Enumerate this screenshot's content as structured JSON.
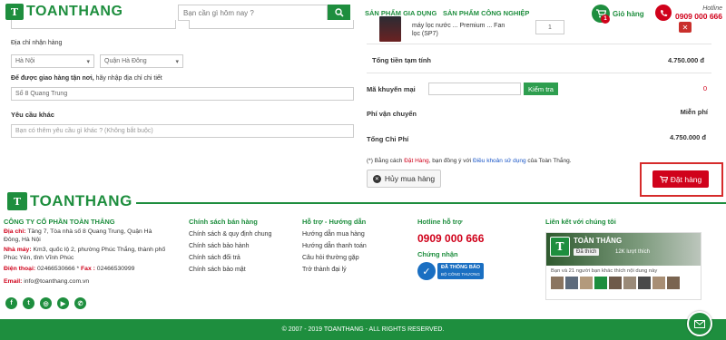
{
  "header": {
    "logo_text": "TOANTHANG",
    "logo_mark": "T",
    "search_placeholder": "Bạn cần gì hôm nay ?",
    "nav": [
      "SẢN PHẨM GIA DỤNG",
      "SẢN PHẨM CÔNG NGHIỆP"
    ],
    "cart_label": "Giỏ hàng",
    "cart_count": "1",
    "hotline_label": "Hotline",
    "hotline_number": "0909 000 666"
  },
  "form": {
    "address_label": "Địa chỉ nhận hàng",
    "city_value": "Hà Nội",
    "district_value": "Quận Hà Đông",
    "delivery_label_bold": "Để được giao hàng tận nơi,",
    "delivery_label_rest": " hãy nhập địa chỉ chi tiết",
    "street_value": "Số 8 Quang Trung",
    "request_label": "Yêu cầu khác",
    "request_placeholder": "Bạn có thêm yêu cầu gì khác ? (Không bắt buộc)"
  },
  "order": {
    "product_name_line1": "máy lọc nước ... Premium ... Fan",
    "product_name_line2": "lọc (SP7)",
    "quantity": "1",
    "subtotal_label": "Tổng tiền tạm tính",
    "subtotal_value": "4.750.000 đ",
    "promo_label": "Mã khuyến mại",
    "promo_button": "Kiểm tra",
    "promo_value": "0",
    "shipping_label": "Phí vận chuyển",
    "shipping_value": "Miễn phí",
    "total_label": "Tổng Chi Phí",
    "total_value": "4.750.000 đ",
    "terms_prefix": "(*) Bằng cách ",
    "terms_order": "Đặt Hàng",
    "terms_mid": ", bạn đồng ý với ",
    "terms_link": "Điều khoản sử dụng",
    "terms_suffix": " của Toàn Thắng.",
    "cancel_button": "Hủy mua hàng",
    "order_button": "Đặt hàng"
  },
  "footer": {
    "company_name": "CÔNG TY CỔ PHẦN TOÀN THẮNG",
    "address_label": "Địa chỉ:",
    "address_value": " Tầng 7, Tòa nhà số 8 Quang Trung, Quận Hà Đông, Hà Nội",
    "factory_label": "Nhà máy:",
    "factory_value": " Km3, quốc lộ 2, phường Phúc Thắng, thành phố Phúc Yên, tỉnh Vĩnh Phúc",
    "phone_label": "Điện thoại:",
    "phone_value": " 02466530666 * ",
    "fax_label": "Fax :",
    "fax_value": " 02466530999",
    "email_label": "Email:",
    "email_value": " info@toanthang.com.vn",
    "policy_title": "Chính sách bán hàng",
    "policy_links": [
      "Chính sách & quy định chung",
      "Chính sách bảo hành",
      "Chính sách đổi trả",
      "Chính sách bảo mật"
    ],
    "support_title": "Hỗ trợ - Hướng dẫn",
    "support_links": [
      "Hướng dẫn mua hàng",
      "Hướng dẫn thanh toán",
      "Câu hỏi thường gặp",
      "Trở thành đại lý"
    ],
    "hotline_title": "Hotline hỗ trợ",
    "hotline_number": "0909 000 666",
    "cert_title": "Chứng nhận",
    "cert_badge_line1": "ĐÃ THÔNG BÁO",
    "cert_badge_line2": "BỘ CÔNG THƯƠNG",
    "connect_title": "Liên kết với chúng tôi",
    "fb_page_name": "TOÀN THẮNG",
    "fb_like": "Đã thích",
    "fb_likes_count": "12K lượt thích",
    "fb_friends_text": "Bạn và 21 người bạn khác thích nội dung này",
    "copyright": "© 2007 - 2019 TOANTHANG - ALL RIGHTS RESERVED."
  },
  "colors": {
    "brand_green": "#1e8e3e",
    "accent_red": "#d0021b"
  }
}
